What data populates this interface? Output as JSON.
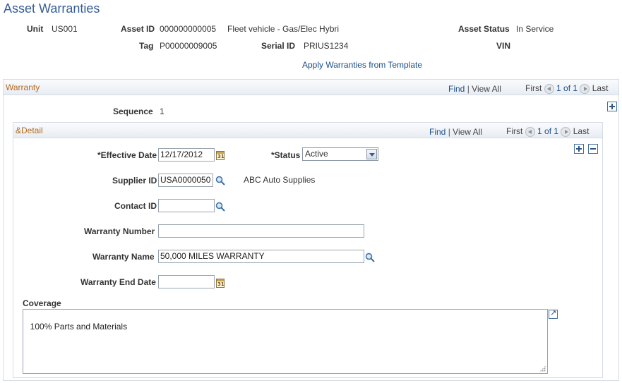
{
  "page": {
    "title": "Asset Warranties"
  },
  "header": {
    "unit_label": "Unit",
    "unit_value": "US001",
    "asset_id_label": "Asset ID",
    "asset_id_value": "000000000005",
    "asset_desc": "Fleet vehicle - Gas/Elec Hybri",
    "asset_status_label": "Asset Status",
    "asset_status_value": "In Service",
    "tag_label": "Tag",
    "tag_value": "P00000009005",
    "serial_id_label": "Serial ID",
    "serial_id_value": "PRIUS1234",
    "vin_label": "VIN",
    "vin_value": "",
    "apply_link": "Apply Warranties from Template"
  },
  "warranty": {
    "title": "Warranty",
    "find": "Find",
    "sep": "|",
    "view_all": "View All",
    "first": "First",
    "page_info": "1 of 1",
    "last": "Last",
    "sequence_label": "Sequence",
    "sequence_value": "1"
  },
  "detail": {
    "title": "&Detail",
    "find": "Find",
    "sep": "|",
    "view_all": "View All",
    "first": "First",
    "page_info": "1 of 1",
    "last": "Last",
    "effective_date_label": "*Effective Date",
    "effective_date_value": "12/17/2012",
    "status_label": "*Status",
    "status_value": "Active",
    "supplier_id_label": "Supplier ID",
    "supplier_id_value": "USA0000050",
    "supplier_name": "ABC Auto Supplies",
    "contact_id_label": "Contact ID",
    "contact_id_value": "",
    "warranty_number_label": "Warranty Number",
    "warranty_number_value": "",
    "warranty_name_label": "Warranty Name",
    "warranty_name_value": "50,000 MILES WARRANTY",
    "warranty_end_date_label": "Warranty End Date",
    "warranty_end_date_value": "",
    "coverage_label": "Coverage",
    "coverage_value": "100% Parts and Materials"
  },
  "icons": {
    "calendar": "calendar-icon",
    "lookup": "magnifier-icon",
    "add": "plus-icon",
    "delete": "minus-icon",
    "expand": "expand-icon",
    "prev": "arrow-left-icon",
    "next": "arrow-right-icon"
  }
}
